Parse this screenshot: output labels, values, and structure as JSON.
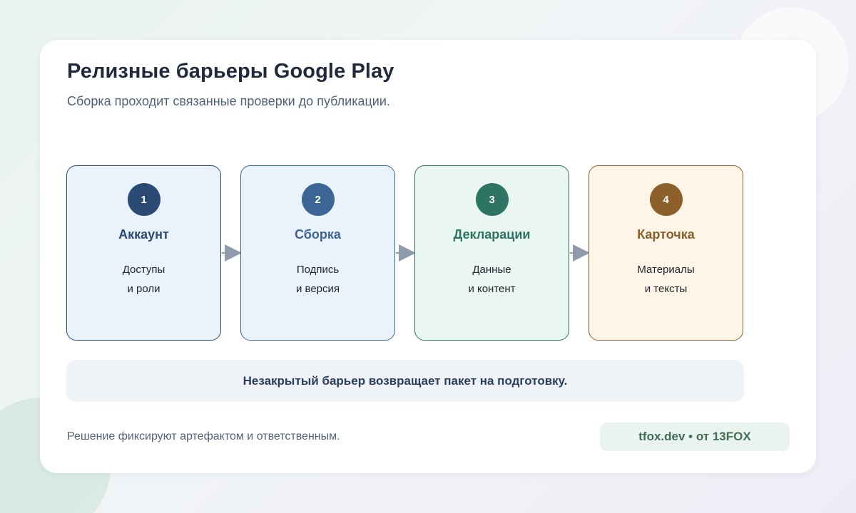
{
  "header": {
    "title": "Релизные барьеры Google Play",
    "subtitle": "Сборка проходит связанные проверки до публикации."
  },
  "steps": [
    {
      "num": "1",
      "name": "Аккаунт",
      "line1": "Доступы",
      "line2": "и роли",
      "accent": "#2b4a73",
      "fill": "#eaf2fb",
      "border": "#2b4a73"
    },
    {
      "num": "2",
      "name": "Сборка",
      "line1": "Подпись",
      "line2": "и версия",
      "accent": "#3b6594",
      "fill": "#eaf2fb",
      "border": "#3b6594"
    },
    {
      "num": "3",
      "name": "Декларации",
      "line1": "Данные",
      "line2": "и контент",
      "accent": "#2e7462",
      "fill": "#e9f6f1",
      "border": "#2e7462"
    },
    {
      "num": "4",
      "name": "Карточка",
      "line1": "Материалы",
      "line2": "и тексты",
      "accent": "#8c5f2b",
      "fill": "#fef4e8",
      "border": "#8c5f2b"
    }
  ],
  "arrow_color": "#8f9bad",
  "banner": {
    "text": "Незакрытый барьер возвращает пакет на подготовку."
  },
  "footer": {
    "note": "Решение фиксируют артефактом и ответственным.",
    "brand": "tfox.dev • от 13FOX"
  }
}
